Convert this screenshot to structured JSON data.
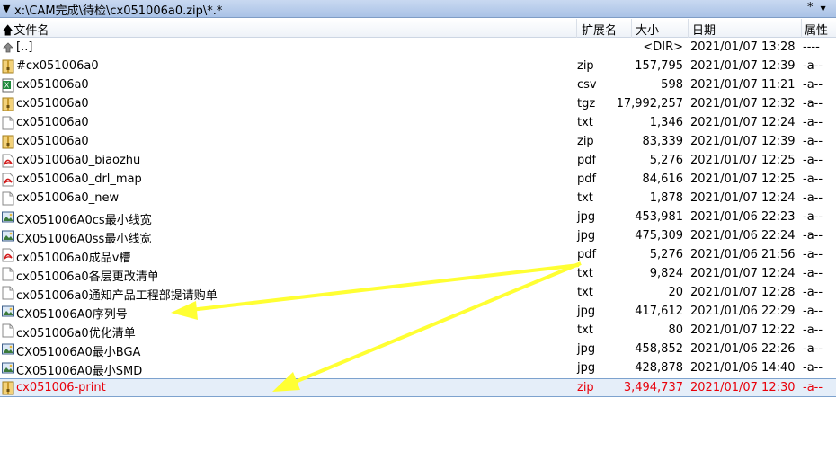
{
  "pathbar": {
    "dropdown_icon": "triangle-down",
    "path": "x:\\CAM完成\\待检\\cx051006a0.zip\\*.*",
    "filter": "*"
  },
  "columns": {
    "name": "文件名",
    "ext": "扩展名",
    "size": "大小",
    "date": "日期",
    "attr": "属性"
  },
  "colors": {
    "selected_text": "#e8000b",
    "arrow": "#ffff33",
    "pathbar": "#b7cbe9"
  },
  "rows": [
    {
      "icon": "up-folder-icon",
      "name": "[..]",
      "ext": "",
      "size": "<DIR>",
      "date": "2021/01/07 13:28",
      "attr": "----"
    },
    {
      "icon": "archive-icon",
      "name": "#cx051006a0",
      "ext": "zip",
      "size": "157,795",
      "date": "2021/01/07 12:39",
      "attr": "-a--"
    },
    {
      "icon": "csv-icon",
      "name": "cx051006a0",
      "ext": "csv",
      "size": "598",
      "date": "2021/01/07 11:21",
      "attr": "-a--"
    },
    {
      "icon": "archive-icon",
      "name": "cx051006a0",
      "ext": "tgz",
      "size": "17,992,257",
      "date": "2021/01/07 12:32",
      "attr": "-a--"
    },
    {
      "icon": "text-file-icon",
      "name": "cx051006a0",
      "ext": "txt",
      "size": "1,346",
      "date": "2021/01/07 12:24",
      "attr": "-a--"
    },
    {
      "icon": "archive-icon",
      "name": "cx051006a0",
      "ext": "zip",
      "size": "83,339",
      "date": "2021/01/07 12:39",
      "attr": "-a--"
    },
    {
      "icon": "pdf-icon",
      "name": "cx051006a0_biaozhu",
      "ext": "pdf",
      "size": "5,276",
      "date": "2021/01/07 12:25",
      "attr": "-a--"
    },
    {
      "icon": "pdf-icon",
      "name": "cx051006a0_drl_map",
      "ext": "pdf",
      "size": "84,616",
      "date": "2021/01/07 12:25",
      "attr": "-a--"
    },
    {
      "icon": "text-file-icon",
      "name": "cx051006a0_new",
      "ext": "txt",
      "size": "1,878",
      "date": "2021/01/07 12:24",
      "attr": "-a--"
    },
    {
      "icon": "image-icon",
      "name": "CX051006A0cs最小线宽",
      "ext": "jpg",
      "size": "453,981",
      "date": "2021/01/06 22:23",
      "attr": "-a--"
    },
    {
      "icon": "image-icon",
      "name": "CX051006A0ss最小线宽",
      "ext": "jpg",
      "size": "475,309",
      "date": "2021/01/06 22:24",
      "attr": "-a--"
    },
    {
      "icon": "pdf-icon",
      "name": "cx051006a0成品v槽",
      "ext": "pdf",
      "size": "5,276",
      "date": "2021/01/06 21:56",
      "attr": "-a--"
    },
    {
      "icon": "text-file-icon",
      "name": "cx051006a0各层更改清单",
      "ext": "txt",
      "size": "9,824",
      "date": "2021/01/07 12:24",
      "attr": "-a--"
    },
    {
      "icon": "text-file-icon",
      "name": "cx051006a0通知产品工程部提请购单",
      "ext": "txt",
      "size": "20",
      "date": "2021/01/07 12:28",
      "attr": "-a--"
    },
    {
      "icon": "image-icon",
      "name": "CX051006A0序列号",
      "ext": "jpg",
      "size": "417,612",
      "date": "2021/01/06 22:29",
      "attr": "-a--"
    },
    {
      "icon": "text-file-icon",
      "name": "cx051006a0优化清单",
      "ext": "txt",
      "size": "80",
      "date": "2021/01/07 12:22",
      "attr": "-a--"
    },
    {
      "icon": "image-icon",
      "name": "CX051006A0最小BGA",
      "ext": "jpg",
      "size": "458,852",
      "date": "2021/01/06 22:26",
      "attr": "-a--"
    },
    {
      "icon": "image-icon",
      "name": "CX051006A0最小SMD",
      "ext": "jpg",
      "size": "428,878",
      "date": "2021/01/06 14:40",
      "attr": "-a--"
    },
    {
      "icon": "archive-icon",
      "name": "cx051006-print",
      "ext": "zip",
      "size": "3,494,737",
      "date": "2021/01/07 12:30",
      "attr": "-a--",
      "selected": true
    }
  ]
}
